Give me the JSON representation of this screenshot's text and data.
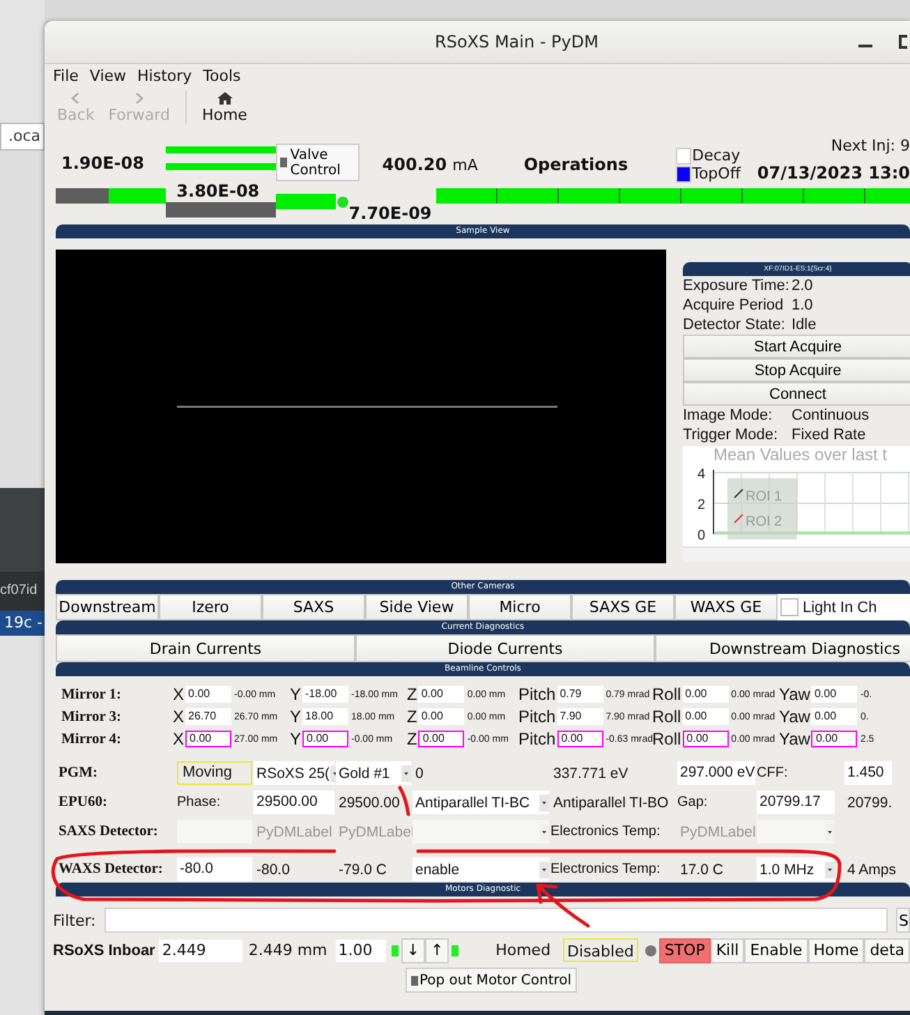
{
  "desktop": {
    "address_fragment": ".oca",
    "terminal_text": "cf07id",
    "taskbar_text": "19c -"
  },
  "window": {
    "title": "RSoXS Main - PyDM"
  },
  "menu": [
    "File",
    "View",
    "History",
    "Tools"
  ],
  "toolbar": [
    {
      "kind": "back",
      "label": "Back",
      "disabled": true
    },
    {
      "kind": "forward",
      "label": "Forward",
      "disabled": true
    },
    {
      "kind": "home",
      "label": "Home",
      "disabled": false
    }
  ],
  "status": {
    "gauge_1": {
      "value": "1.90E-08",
      "level": 0.52
    },
    "gauge_2": {
      "value": "3.80E-08",
      "rails": [
        {
          "level": 1
        },
        {
          "level": 1
        }
      ],
      "level": 0
    },
    "valve_button": "Valve Control",
    "gauge_3": {
      "value": "7.70E-09",
      "level": 1,
      "led_on": true
    },
    "current": "400.20",
    "current_unit": "mA",
    "mode": "Operations",
    "fill_modes": [
      {
        "label": "Decay",
        "selected": false
      },
      {
        "label": "TopOff",
        "selected": true
      }
    ],
    "current_bar": {
      "level": 1
    },
    "next_injection": "Next Inj: 9",
    "datetime": "07/13/2023 13:0"
  },
  "sample_view": {
    "title": "Sample View",
    "detector": {
      "title": "XF:07ID1-ES:1{Scr:4}",
      "fields": [
        {
          "label": "Exposure Time:",
          "value": "2.0"
        },
        {
          "label": "Acquire Period",
          "value": "1.0"
        },
        {
          "label": "Detector State:",
          "value": "Idle"
        }
      ],
      "buttons": [
        "Start Acquire",
        "Stop Acquire",
        "Connect"
      ],
      "modes": [
        {
          "label": "Image Mode:",
          "value": "Continuous"
        },
        {
          "label": "Trigger Mode:",
          "value": "Fixed Rate"
        }
      ],
      "chart_data": {
        "type": "line",
        "title": "Mean Values over last t",
        "ylim": [
          0,
          4
        ],
        "yticks": [
          0,
          2,
          4
        ],
        "legend": "lower left",
        "series": [
          {
            "name": "ROI 1",
            "color": "#303030"
          },
          {
            "name": "ROI 2",
            "color": "#e03030"
          }
        ]
      }
    }
  },
  "other_cameras": {
    "title": "Other Cameras",
    "buttons": [
      "Downstream",
      "Izero",
      "SAXS",
      "Side View",
      "Micro",
      "SAXS GE",
      "WAXS GE"
    ],
    "checkbox": {
      "label": "Light In Ch",
      "checked": false
    }
  },
  "current_diagnostics": {
    "title": "Current Diagnostics",
    "buttons": [
      "Drain Currents",
      "Diode Currents",
      "Downstream Diagnostics"
    ]
  },
  "beamline_controls": {
    "title": "Beamline Controls",
    "mirrors": [
      {
        "label": "Mirror 1:",
        "axes": [
          {
            "axis": "X",
            "setpoint": "0.00",
            "readback": "-0.00 mm",
            "alarm": false
          },
          {
            "axis": "Y",
            "setpoint": "-18.00",
            "readback": "-18.00 mm",
            "alarm": false
          },
          {
            "axis": "Z",
            "setpoint": "0.00",
            "readback": "0.00 mm",
            "alarm": false
          },
          {
            "axis": "Pitch",
            "setpoint": "0.79",
            "readback": "0.79 mrad",
            "alarm": false
          },
          {
            "axis": "Roll",
            "setpoint": "0.00",
            "readback": "0.00 mrad",
            "alarm": false
          },
          {
            "axis": "Yaw",
            "setpoint": "0.00",
            "readback": "-0.",
            "alarm": false
          }
        ]
      },
      {
        "label": "Mirror 3:",
        "axes": [
          {
            "axis": "X",
            "setpoint": "26.70",
            "readback": "26.70 mm",
            "alarm": false
          },
          {
            "axis": "Y",
            "setpoint": "18.00",
            "readback": "18.00 mm",
            "alarm": false
          },
          {
            "axis": "Z",
            "setpoint": "0.00",
            "readback": "0.00 mm",
            "alarm": false
          },
          {
            "axis": "Pitch",
            "setpoint": "7.90",
            "readback": "7.90 mrad",
            "alarm": false
          },
          {
            "axis": "Roll",
            "setpoint": "0.00",
            "readback": "0.00 mrad",
            "alarm": false
          },
          {
            "axis": "Yaw",
            "setpoint": "0.00",
            "readback": "0.",
            "alarm": false
          }
        ]
      },
      {
        "label": "Mirror 4:",
        "axes": [
          {
            "axis": "X",
            "setpoint": "0.00",
            "readback": "27.00 mm",
            "alarm": true
          },
          {
            "axis": "Y",
            "setpoint": "0.00",
            "readback": "-0.00 mm",
            "alarm": true
          },
          {
            "axis": "Z",
            "setpoint": "0.00",
            "readback": "-0.00 mm",
            "alarm": true
          },
          {
            "axis": "Pitch",
            "setpoint": "0.00",
            "readback": "-0.63 mrad",
            "alarm": true
          },
          {
            "axis": "Roll",
            "setpoint": "0.00",
            "readback": "0.00 mrad",
            "alarm": true
          },
          {
            "axis": "Yaw",
            "setpoint": "0.00",
            "readback": "2.5",
            "alarm": true
          }
        ]
      }
    ],
    "rows": [
      {
        "label": "PGM:",
        "disabled": false,
        "cells": [
          {
            "kind": "status",
            "text": "Moving"
          },
          {
            "kind": "combo",
            "text": "RSoXS 25("
          },
          {
            "kind": "combo",
            "text": "Gold #1"
          },
          {
            "kind": "text",
            "text": "0"
          },
          {
            "kind": "text",
            "text": "337.771 eV"
          },
          {
            "kind": "field",
            "text": "297.000 eV"
          },
          {
            "kind": "label",
            "text": "CFF:"
          },
          {
            "kind": "field",
            "text": "1.450"
          }
        ]
      },
      {
        "label": "EPU60:",
        "disabled": false,
        "cells": [
          {
            "kind": "label",
            "text": "Phase:"
          },
          {
            "kind": "field",
            "text": "29500.00"
          },
          {
            "kind": "text",
            "text": "29500.00"
          },
          {
            "kind": "combo",
            "text": "Antiparallel TI-BC"
          },
          {
            "kind": "text",
            "text": "Antiparallel TI-BO"
          },
          {
            "kind": "label",
            "text": "Gap:"
          },
          {
            "kind": "field",
            "text": "20799.17"
          },
          {
            "kind": "text",
            "text": "20799."
          }
        ]
      },
      {
        "label": "SAXS Detector:",
        "disabled": true,
        "cells": [
          {
            "kind": "field"
          },
          {
            "kind": "text",
            "text": "PyDMLabel"
          },
          {
            "kind": "text",
            "text": "PyDMLabel"
          },
          {
            "kind": "combo"
          },
          {
            "kind": "label",
            "text": "Electronics Temp:"
          },
          {
            "kind": "text",
            "text": "PyDMLabel"
          },
          {
            "kind": "combo"
          }
        ]
      },
      {
        "label": "WAXS Detector:",
        "disabled": false,
        "cells": [
          {
            "kind": "field",
            "text": "-80.0"
          },
          {
            "kind": "text",
            "text": "-80.0"
          },
          {
            "kind": "text",
            "text": "-79.0 C"
          },
          {
            "kind": "combo",
            "text": "enable"
          },
          {
            "kind": "label",
            "text": "Electronics Temp:"
          },
          {
            "kind": "text",
            "text": "17.0 C"
          },
          {
            "kind": "combo",
            "text": "1.0 MHz"
          },
          {
            "kind": "text",
            "text": "4 Amps"
          }
        ]
      }
    ]
  },
  "motors_diagnostic": {
    "title": "Motors Diagnostic",
    "filter_label": "Filter:",
    "filter_button": "S",
    "motor": [
      {
        "kind": "name",
        "text": "RSoXS Inboar"
      },
      {
        "kind": "field",
        "text": "2.449"
      },
      {
        "kind": "text",
        "text": "2.449 mm"
      },
      {
        "kind": "spin",
        "text": "1.00"
      },
      {
        "kind": "led",
        "on": true
      },
      {
        "kind": "button",
        "text": "↓"
      },
      {
        "kind": "button",
        "text": "↑"
      },
      {
        "kind": "led",
        "on": true
      },
      {
        "kind": "spacer"
      },
      {
        "kind": "text",
        "text": "Homed"
      },
      {
        "kind": "status",
        "text": "Disabled"
      },
      {
        "kind": "led",
        "on": false
      },
      {
        "kind": "stop",
        "text": "STOP"
      },
      {
        "kind": "button",
        "text": "Kill"
      },
      {
        "kind": "button",
        "text": "Enable"
      },
      {
        "kind": "button",
        "text": "Home"
      },
      {
        "kind": "button",
        "text": "deta"
      }
    ],
    "popout_button": "Pop out Motor Control"
  }
}
